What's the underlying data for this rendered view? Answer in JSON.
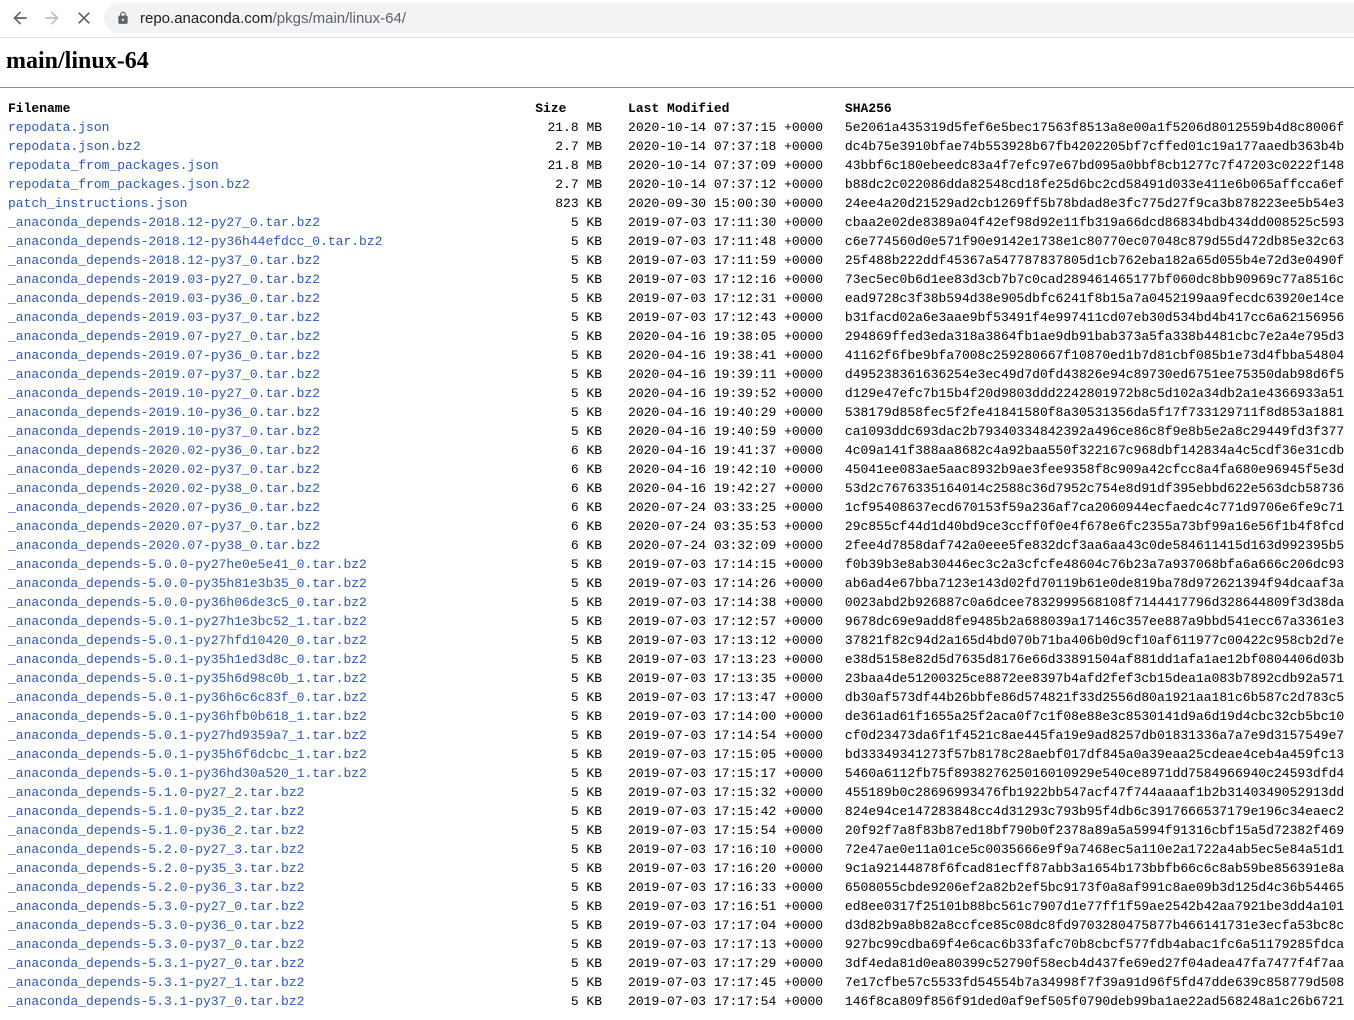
{
  "browser": {
    "url_host": "repo.anaconda.com",
    "url_path": "/pkgs/main/linux-64/"
  },
  "page": {
    "title": "main/linux-64"
  },
  "table": {
    "headers": [
      "Filename",
      "Size",
      "Last Modified",
      "SHA256"
    ],
    "rows": [
      [
        "repodata.json",
        "21.8 MB",
        "2020-10-14 07:37:15 +0000",
        "5e2061a435319d5fef6e5bec17563f8513a8e00a1f5206d8012559b4d8c8006f"
      ],
      [
        "repodata.json.bz2",
        "2.7 MB",
        "2020-10-14 07:37:18 +0000",
        "dc4b75e3910bfae74b553928b67fb4202205bf7cffed01c19a177aaedb363b4b"
      ],
      [
        "repodata_from_packages.json",
        "21.8 MB",
        "2020-10-14 07:37:09 +0000",
        "43bbf6c180ebeedc83a4f7efc97e67bd095a0bbf8cb1277c7f47203c0222f148"
      ],
      [
        "repodata_from_packages.json.bz2",
        "2.7 MB",
        "2020-10-14 07:37:12 +0000",
        "b88dc2c022086dda82548cd18fe25d6bc2cd58491d033e411e6b065affcca6ef"
      ],
      [
        "patch_instructions.json",
        "823 KB",
        "2020-09-30 15:00:30 +0000",
        "24ee4a20d21529ad2cb1269ff5b78bdad8e3fc775d27f9ca3b878223ee5b54e3"
      ],
      [
        "_anaconda_depends-2018.12-py27_0.tar.bz2",
        "5 KB",
        "2019-07-03 17:11:30 +0000",
        "cbaa2e02de8389a04f42ef98d92e11fb319a66dcd86834bdb434dd008525c593"
      ],
      [
        "_anaconda_depends-2018.12-py36h44efdcc_0.tar.bz2",
        "5 KB",
        "2019-07-03 17:11:48 +0000",
        "c6e774560d0e571f90e9142e1738e1c80770ec07048c879d55d472db85e32c63"
      ],
      [
        "_anaconda_depends-2018.12-py37_0.tar.bz2",
        "5 KB",
        "2019-07-03 17:11:59 +0000",
        "25f488b222ddf45367a547787837805d1cb762eba182a65d055b4e72d3e0490f"
      ],
      [
        "_anaconda_depends-2019.03-py27_0.tar.bz2",
        "5 KB",
        "2019-07-03 17:12:16 +0000",
        "73ec5ec0b6d1ee83d3cb7b7c0cad289461465177bf060dc8bb90969c77a8516c"
      ],
      [
        "_anaconda_depends-2019.03-py36_0.tar.bz2",
        "5 KB",
        "2019-07-03 17:12:31 +0000",
        "ead9728c3f38b594d38e905dbfc6241f8b15a7a0452199aa9fecdc63920e14ce"
      ],
      [
        "_anaconda_depends-2019.03-py37_0.tar.bz2",
        "5 KB",
        "2019-07-03 17:12:43 +0000",
        "b31facd02a6e3aae9bf53491f4e997411cd07eb30d534bd4b417cc6a62156956"
      ],
      [
        "_anaconda_depends-2019.07-py27_0.tar.bz2",
        "5 KB",
        "2020-04-16 19:38:05 +0000",
        "294869ffed3eda318a3864fb1ae9db91bab373a5fa338b4481cbc7e2a4e795d3"
      ],
      [
        "_anaconda_depends-2019.07-py36_0.tar.bz2",
        "5 KB",
        "2020-04-16 19:38:41 +0000",
        "41162f6fbe9bfa7008c259280667f10870ed1b7d81cbf085b1e73d4fbba54804"
      ],
      [
        "_anaconda_depends-2019.07-py37_0.tar.bz2",
        "5 KB",
        "2020-04-16 19:39:11 +0000",
        "d495238361636254e3ec49d7d0fd43826e94c89730ed6751ee75350dab98d6f5"
      ],
      [
        "_anaconda_depends-2019.10-py27_0.tar.bz2",
        "5 KB",
        "2020-04-16 19:39:52 +0000",
        "d129e47efc7b15b4f20d9803ddd2242801972b8c5d102a34db2a1e4366933a51"
      ],
      [
        "_anaconda_depends-2019.10-py36_0.tar.bz2",
        "5 KB",
        "2020-04-16 19:40:29 +0000",
        "538179d858fec5f2fe41841580f8a30531356da5f17f733129711f8d853a1881"
      ],
      [
        "_anaconda_depends-2019.10-py37_0.tar.bz2",
        "5 KB",
        "2020-04-16 19:40:59 +0000",
        "ca1093ddc693dac2b79340334842392a496ce86c8f9e8b5e2a8c29449fd3f377"
      ],
      [
        "_anaconda_depends-2020.02-py36_0.tar.bz2",
        "6 KB",
        "2020-04-16 19:41:37 +0000",
        "4c09a141f388aa8682c4a92baa550f322167c968dbf142834a4c5cdf36e31cdb"
      ],
      [
        "_anaconda_depends-2020.02-py37_0.tar.bz2",
        "6 KB",
        "2020-04-16 19:42:10 +0000",
        "45041ee083ae5aac8932b9ae3fee9358f8c909a42cfcc8a4fa680e96945f5e3d"
      ],
      [
        "_anaconda_depends-2020.02-py38_0.tar.bz2",
        "6 KB",
        "2020-04-16 19:42:27 +0000",
        "53d2c7676335164014c2588c36d7952c754e8d91df395ebbd622e563dcb58736"
      ],
      [
        "_anaconda_depends-2020.07-py36_0.tar.bz2",
        "6 KB",
        "2020-07-24 03:33:25 +0000",
        "1cf95408637ecd670153f59a236af7ca2060944ecfaedc4c771d9706e6fe9c71"
      ],
      [
        "_anaconda_depends-2020.07-py37_0.tar.bz2",
        "6 KB",
        "2020-07-24 03:35:53 +0000",
        "29c855cf44d1d40bd9ce3ccff0f0e4f678e6fc2355a73bf99a16e56f1b4f8fcd"
      ],
      [
        "_anaconda_depends-2020.07-py38_0.tar.bz2",
        "6 KB",
        "2020-07-24 03:32:09 +0000",
        "2fee4d7858daf742a0eee5fe832dcf3aa6aa43c0de584611415d163d992395b5"
      ],
      [
        "_anaconda_depends-5.0.0-py27he0e5e41_0.tar.bz2",
        "5 KB",
        "2019-07-03 17:14:15 +0000",
        "f0b39b3e8ab30446ec3c2a3cfcfe48604c76b23a7a937068bfa6a666c206dc93"
      ],
      [
        "_anaconda_depends-5.0.0-py35h81e3b35_0.tar.bz2",
        "5 KB",
        "2019-07-03 17:14:26 +0000",
        "ab6ad4e67bba7123e143d02fd70119b61e0de819ba78d972621394f94dcaaf3a"
      ],
      [
        "_anaconda_depends-5.0.0-py36h06de3c5_0.tar.bz2",
        "5 KB",
        "2019-07-03 17:14:38 +0000",
        "0023abd2b926887c0a6dcee7832999568108f7144417796d328644809f3d38da"
      ],
      [
        "_anaconda_depends-5.0.1-py27h1e3bc52_1.tar.bz2",
        "5 KB",
        "2019-07-03 17:12:57 +0000",
        "9678dc69e9add8fe9485b2a688039a17146c357ee887a9bbd541ecc67a3361e3"
      ],
      [
        "_anaconda_depends-5.0.1-py27hfd10420_0.tar.bz2",
        "5 KB",
        "2019-07-03 17:13:12 +0000",
        "37821f82c94d2a165d4bd070b71ba406b0d9cf10af611977c00422c958cb2d7e"
      ],
      [
        "_anaconda_depends-5.0.1-py35h1ed3d8c_0.tar.bz2",
        "5 KB",
        "2019-07-03 17:13:23 +0000",
        "e38d5158e82d5d7635d8176e66d33891504af881dd1afa1ae12bf0804406d03b"
      ],
      [
        "_anaconda_depends-5.0.1-py35h6d98c0b_1.tar.bz2",
        "5 KB",
        "2019-07-03 17:13:35 +0000",
        "23baa4de51200325ce8872ee8397b4afd2fef3cb15dea1a083b7892cdb92a571"
      ],
      [
        "_anaconda_depends-5.0.1-py36h6c6c83f_0.tar.bz2",
        "5 KB",
        "2019-07-03 17:13:47 +0000",
        "db30af573df44b26bbfe86d574821f33d2556d80a1921aa181c6b587c2d783c5"
      ],
      [
        "_anaconda_depends-5.0.1-py36hfb0b618_1.tar.bz2",
        "5 KB",
        "2019-07-03 17:14:00 +0000",
        "de361ad61f1655a25f2aca0f7c1f08e88e3c8530141d9a6d19d4cbc32cb5bc10"
      ],
      [
        "_anaconda_depends-5.0.1-py27hd9359a7_1.tar.bz2",
        "5 KB",
        "2019-07-03 17:14:54 +0000",
        "cf0d23473da6f1f4521c8ae445fa19e9ad8257db01831336a7a7e9d3157549e7"
      ],
      [
        "_anaconda_depends-5.0.1-py35h6f6dcbc_1.tar.bz2",
        "5 KB",
        "2019-07-03 17:15:05 +0000",
        "bd33349341273f57b8178c28aebf017df845a0a39eaa25cdeae4ceb4a459fc13"
      ],
      [
        "_anaconda_depends-5.0.1-py36hd30a520_1.tar.bz2",
        "5 KB",
        "2019-07-03 17:15:17 +0000",
        "5460a6112fb75f893827625016010929e540ce8971dd7584966940c24593dfd4"
      ],
      [
        "_anaconda_depends-5.1.0-py27_2.tar.bz2",
        "5 KB",
        "2019-07-03 17:15:32 +0000",
        "455189b0c28696993476fb1922bb547acf47f744aaaaf1b2b3140349052913dd"
      ],
      [
        "_anaconda_depends-5.1.0-py35_2.tar.bz2",
        "5 KB",
        "2019-07-03 17:15:42 +0000",
        "824e94ce147283848cc4d31293c793b95f4db6c3917666537179e196c34eaec2"
      ],
      [
        "_anaconda_depends-5.1.0-py36_2.tar.bz2",
        "5 KB",
        "2019-07-03 17:15:54 +0000",
        "20f92f7a8f83b87ed18bf790b0f2378a89a5a5994f91316cbf15a5d72382f469"
      ],
      [
        "_anaconda_depends-5.2.0-py27_3.tar.bz2",
        "5 KB",
        "2019-07-03 17:16:10 +0000",
        "72e47ae0e11a01ce5c0035666e9f9a7468ec5a110e2a1722a4ab5ec5e84a51d1"
      ],
      [
        "_anaconda_depends-5.2.0-py35_3.tar.bz2",
        "5 KB",
        "2019-07-03 17:16:20 +0000",
        "9c1a92144878f6fcad81ecff87abb3a1654b173bbfb66c6c8ab59be856391e8a"
      ],
      [
        "_anaconda_depends-5.2.0-py36_3.tar.bz2",
        "5 KB",
        "2019-07-03 17:16:33 +0000",
        "6508055cbde9206ef2a82b2ef5bc9173f0a8af991c8ae09b3d125d4c36b54465"
      ],
      [
        "_anaconda_depends-5.3.0-py27_0.tar.bz2",
        "5 KB",
        "2019-07-03 17:16:51 +0000",
        "ed8ee0317f25101b88bc561c7907d1e77ff1f59ae2542b42aa7921be3dd4a101"
      ],
      [
        "_anaconda_depends-5.3.0-py36_0.tar.bz2",
        "5 KB",
        "2019-07-03 17:17:04 +0000",
        "d3d82b9a8b82a8ccfce85c08dc8fd9703280475877b466141731e3ecfa53bc8c"
      ],
      [
        "_anaconda_depends-5.3.0-py37_0.tar.bz2",
        "5 KB",
        "2019-07-03 17:17:13 +0000",
        "927bc99cdba69f4e6cac6b33fafc70b8cbcf577fdb4abac1fc6a51179285fdca"
      ],
      [
        "_anaconda_depends-5.3.1-py27_0.tar.bz2",
        "5 KB",
        "2019-07-03 17:17:29 +0000",
        "3df4eda81d0ea80399c52790f58ecb4d437fe69ed27f04adea47fa7477f4f7aa"
      ],
      [
        "_anaconda_depends-5.3.1-py27_1.tar.bz2",
        "5 KB",
        "2019-07-03 17:17:45 +0000",
        "7e17cfbe57c5533fd54554b7a34998f7f39a91d96f5fd47dde639c858779d508"
      ],
      [
        "_anaconda_depends-5.3.1-py37_0.tar.bz2",
        "5 KB",
        "2019-07-03 17:17:54 +0000",
        "146f8ca809f856f91ded0af9ef505f0790deb99ba1ae22ad568248a1c26b6721"
      ]
    ]
  }
}
